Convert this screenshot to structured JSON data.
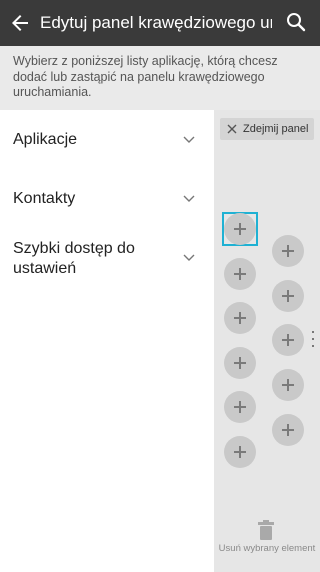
{
  "appbar": {
    "title": "Edytuj panel krawędziowego uruc",
    "back_icon": "back-arrow-icon",
    "search_icon": "search-icon"
  },
  "description": "Wybierz z poniższej listy aplikację, którą chcesz dodać lub zastąpić na panelu krawędziowego uruchamiania.",
  "categories": [
    {
      "label": "Aplikacje"
    },
    {
      "label": "Kontakty"
    },
    {
      "label": "Szybki dostęp do ustawień"
    }
  ],
  "panel": {
    "remove_panel_label": "Zdejmij panel",
    "remove_selected_label": "Usuń wybrany element",
    "slot_count": 11
  },
  "colors": {
    "appbar": "#3a3a3a",
    "accent": "#1fb1d3",
    "panel_bg": "#e6e6e6"
  }
}
